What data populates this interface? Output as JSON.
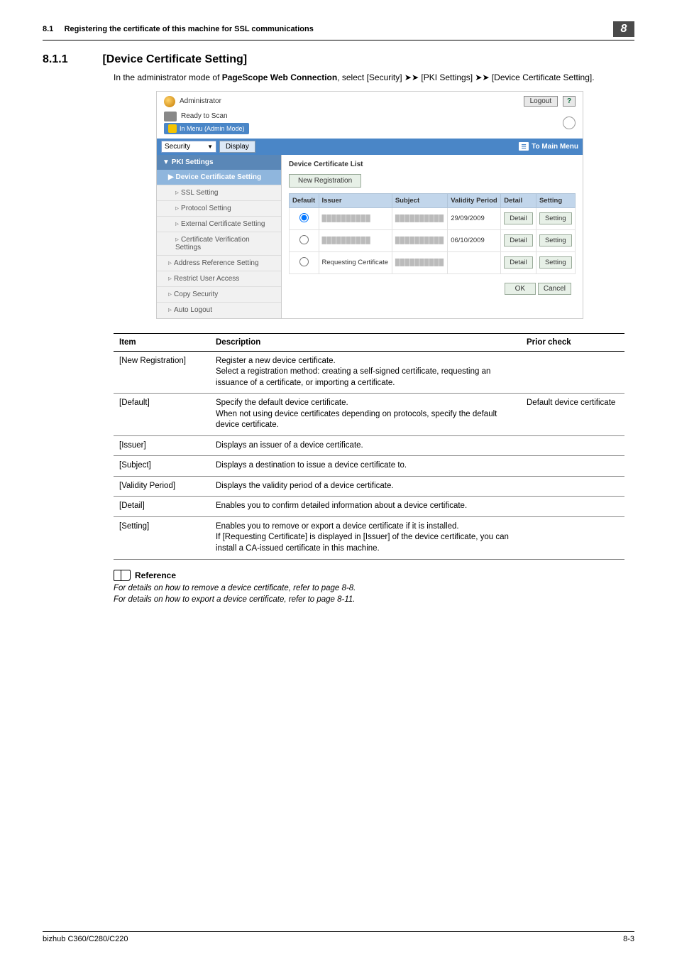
{
  "header": {
    "section_number": "8.1",
    "section_title": "Registering the certificate of this machine for SSL communications",
    "chapter_badge": "8"
  },
  "heading": {
    "number": "8.1.1",
    "title": "[Device Certificate Setting]"
  },
  "intro": {
    "pre": "In the administrator mode of ",
    "bold": "PageScope Web Connection",
    "post": ", select [Security] ➤➤ [PKI Settings] ➤➤ [Device Certificate Setting]."
  },
  "screenshot": {
    "administrator": "Administrator",
    "logout": "Logout",
    "help": "?",
    "ready": "Ready to Scan",
    "mode": "In Menu (Admin Mode)",
    "dropdown": "Security",
    "display_btn": "Display",
    "to_main": "To Main Menu",
    "nav": {
      "pki": "PKI Settings",
      "device_cert": "Device Certificate Setting",
      "ssl": "SSL Setting",
      "protocol": "Protocol Setting",
      "ext_cert": "External Certificate Setting",
      "cert_verif": "Certificate Verification Settings",
      "addr_ref": "Address Reference Setting",
      "restrict": "Restrict User Access",
      "copy_sec": "Copy Security",
      "auto_logout": "Auto Logout"
    },
    "main": {
      "title": "Device Certificate List",
      "new_reg": "New Registration",
      "cols": {
        "default": "Default",
        "issuer": "Issuer",
        "subject": "Subject",
        "validity": "Validity Period",
        "detail": "Detail",
        "setting": "Setting"
      },
      "rows": [
        {
          "validity": "29/09/2009",
          "issuer": "",
          "subject": "",
          "requesting": ""
        },
        {
          "validity": "06/10/2009",
          "issuer": "",
          "subject": "",
          "requesting": ""
        },
        {
          "validity": "",
          "issuer": "",
          "subject": "",
          "requesting": "Requesting Certificate"
        }
      ],
      "detail_btn": "Detail",
      "setting_btn": "Setting",
      "ok": "OK",
      "cancel": "Cancel"
    }
  },
  "desc_table": {
    "headers": {
      "item": "Item",
      "description": "Description",
      "prior": "Prior check"
    },
    "rows": [
      {
        "item": "[New Registration]",
        "description": "Register a new device certificate.\nSelect a registration method: creating a self-signed certificate, requesting an issuance of a certificate, or importing a certificate.",
        "prior": ""
      },
      {
        "item": "[Default]",
        "description": "Specify the default device certificate.\nWhen not using device certificates depending on protocols, specify the default device certificate.",
        "prior": "Default device certificate"
      },
      {
        "item": "[Issuer]",
        "description": "Displays an issuer of a device certificate.",
        "prior": ""
      },
      {
        "item": "[Subject]",
        "description": "Displays a destination to issue a device certificate to.",
        "prior": ""
      },
      {
        "item": "[Validity Period]",
        "description": "Displays the validity period of a device certificate.",
        "prior": ""
      },
      {
        "item": "[Detail]",
        "description": "Enables you to confirm detailed information about a device certificate.",
        "prior": ""
      },
      {
        "item": "[Setting]",
        "description": "Enables you to remove or export a device certificate if it is installed.\nIf [Requesting Certificate] is displayed in [Issuer] of the device certificate, you can install a CA-issued certificate in this machine.",
        "prior": ""
      }
    ]
  },
  "reference": {
    "label": "Reference",
    "lines": [
      "For details on how to remove a device certificate, refer to page 8-8.",
      "For details on how to export a device certificate, refer to page 8-11."
    ]
  },
  "footer": {
    "left": "bizhub C360/C280/C220",
    "right": "8-3"
  }
}
